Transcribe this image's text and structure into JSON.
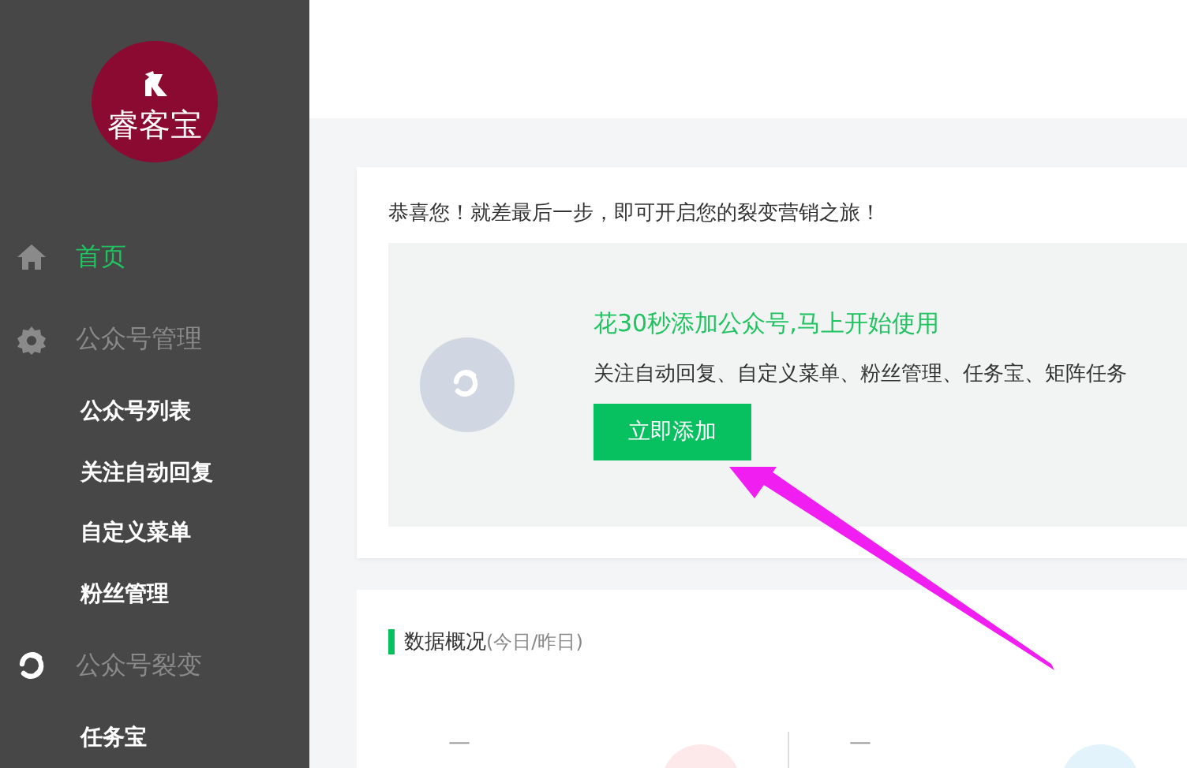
{
  "logo": {
    "text": "睿客宝"
  },
  "sidebar": {
    "items": [
      {
        "kind": "section",
        "label": "首页",
        "selected": true
      },
      {
        "kind": "section",
        "label": "公众号管理",
        "selected": false
      },
      {
        "kind": "sub",
        "label": "公众号列表",
        "selected": false
      },
      {
        "kind": "sub",
        "label": "关注自动回复",
        "selected": false
      },
      {
        "kind": "sub",
        "label": "自定义菜单",
        "selected": false
      },
      {
        "kind": "sub",
        "label": "粉丝管理",
        "selected": false
      },
      {
        "kind": "section",
        "label": "公众号裂变",
        "selected": false
      },
      {
        "kind": "sub",
        "label": "任务宝",
        "selected": false
      }
    ]
  },
  "welcome": {
    "message": "恭喜您！就差最后一步，即可开启您的裂变营销之旅！",
    "promo": {
      "title": "花30秒添加公众号,马上开始使用",
      "features": "关注自动回复、自定义菜单、粉丝管理、任务宝、矩阵任务",
      "button": "立即添加"
    }
  },
  "overview": {
    "title": "数据概况",
    "subtitle": "(今日/昨日)",
    "stats": [
      {
        "value": "—",
        "color": "#fde8ea"
      },
      {
        "value": "—",
        "color": "#e3f3fc"
      }
    ]
  }
}
